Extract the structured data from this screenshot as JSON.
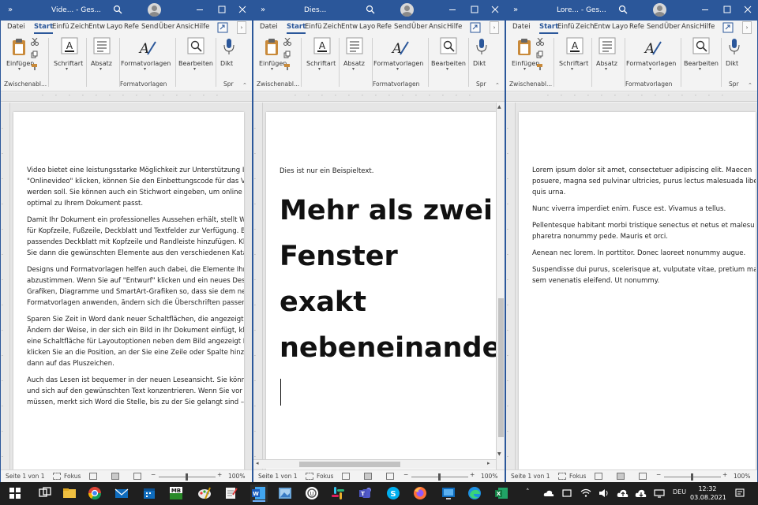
{
  "ribbon": {
    "tabs": [
      "Datei",
      "Start",
      "Einfü",
      "Zeich",
      "Entw",
      "Layo",
      "Refe",
      "Send",
      "Über",
      "Ansic",
      "Hilfe"
    ],
    "active_tab": "Start",
    "groups": {
      "einfuegen": "Einfügen",
      "zwischenablage": "Zwischenabl...",
      "schriftart": "Schriftart",
      "absatz": "Absatz",
      "formatvorlagen": "Formatvorlagen",
      "formatvorlagen_group": "Formatvorlagen",
      "bearbeiten": "Bearbeiten",
      "diktieren": "Dikt",
      "sprache": "Spr"
    }
  },
  "windows": [
    {
      "title": "Vide... - Ges...",
      "status": {
        "page": "Seite 1 von 1",
        "focus": "Fokus",
        "zoom": "100%"
      },
      "paragraphs": [
        "Video bietet eine leistungsstarke Möglichkeit zur Unterstützung Ih\n\"Onlinevideo\" klicken, können Sie den Einbettungscode für das Vi\nwerden soll. Sie können auch ein Stichwort eingeben, um online n\noptimal zu Ihrem Dokument passt.",
        "Damit Ihr Dokument ein professionelles Aussehen erhält, stellt W\nfür Kopfzeile, Fußzeile, Deckblatt und Textfelder zur Verfügung. B\npassendes Deckblatt mit Kopfzeile und Randleiste hinzufügen. Kli\nSie dann die gewünschten Elemente aus den verschiedenen Katal",
        "Designs und Formatvorlagen helfen auch dabei, die Elemente Ihre\nabzustimmen. Wenn Sie auf \"Entwurf\" klicken und ein neues Desi\nGrafiken, Diagramme und SmartArt-Grafiken so, dass sie dem neu\nFormatvorlagen anwenden, ändern sich die Überschriften passen",
        "Sparen Sie Zeit in Word dank neuer Schaltflächen, die angezeigt w\nÄndern der Weise, in der sich ein Bild in Ihr Dokument einfügt, kli\neine Schaltfläche für Layoutoptionen neben dem Bild angezeigt Be\nklicken Sie an die Position, an der Sie eine Zeile oder Spalte hinzuf\ndann auf das Pluszeichen.",
        "Auch das Lesen ist bequemer in der neuen Leseansicht. Sie könne\nund sich auf den gewünschten Text konzentrieren. Wenn Sie vor d\nmüssen, merkt sich Word die Stelle, bis zu der Sie gelangt sind – s"
      ]
    },
    {
      "title": "Dies...",
      "status": {
        "page": "Seite 1 von 1",
        "focus": "Fokus",
        "zoom": "100%"
      },
      "small_text": "Dies ist nur ein Beispieltext.",
      "heading": "Mehr als zwei\nFenster exakt\nnebeneinander."
    },
    {
      "title": "Lore... - Ges...",
      "status": {
        "page": "Seite 1 von 1",
        "focus": "Fokus",
        "zoom": "100%"
      },
      "paragraphs": [
        "Lorem ipsum dolor sit amet, consectetuer adipiscing elit. Maecen\nposuere, magna sed pulvinar ultricies, purus lectus malesuada libe\nquis urna.",
        "Nunc viverra imperdiet enim. Fusce est. Vivamus a tellus.",
        "Pellentesque habitant morbi tristique senectus et netus et malesu\npharetra nonummy pede. Mauris et orci.",
        "Aenean nec lorem. In porttitor. Donec laoreet nonummy augue.",
        "Suspendisse dui purus, scelerisque at, vulputate vitae, pretium ma\nsem venenatis eleifend. Ut nonummy."
      ]
    }
  ],
  "taskbar": {
    "language": "DEU",
    "time": "12:32",
    "date": "03.08.2021",
    "apps": [
      "start-icon",
      "search-icon",
      "task-view-icon",
      "file-explorer-icon",
      "chrome-icon",
      "mail-icon",
      "calendar-icon",
      "mediabrowser-icon",
      "paint-icon",
      "notepad-icon",
      "word-icon",
      "photos-icon",
      "unknown-app-icon",
      "slack-icon",
      "teams-icon",
      "skype-icon",
      "firefox-icon",
      "remote-desktop-icon",
      "edge-icon",
      "excel-icon"
    ],
    "colors": {
      "word_blue": "#2b579a",
      "taskbar": "#1f1f1f"
    }
  }
}
